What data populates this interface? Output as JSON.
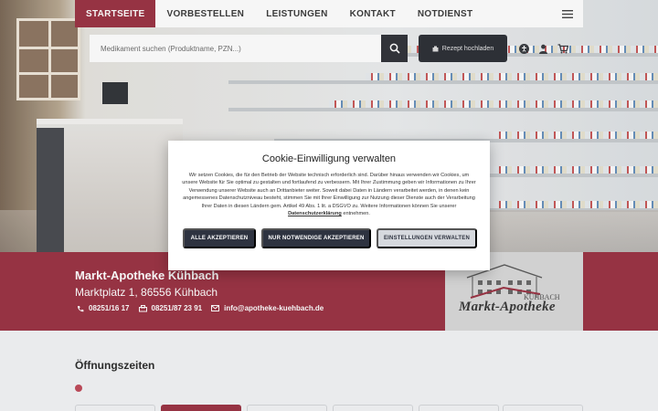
{
  "nav": {
    "items": [
      {
        "label": "STARTSEITE",
        "active": true
      },
      {
        "label": "VORBESTELLEN",
        "active": false
      },
      {
        "label": "LEISTUNGEN",
        "active": false
      },
      {
        "label": "KONTAKT",
        "active": false
      },
      {
        "label": "NOTDIENST",
        "active": false
      }
    ],
    "menu_icon": "hamburger-icon"
  },
  "search": {
    "placeholder": "Medikament suchen (Produktname, PZN...)",
    "button_icon": "search-icon"
  },
  "prescription_button": {
    "label": "Rezept hochladen",
    "icon": "upload-icon"
  },
  "header_icons": [
    "accessibility-icon",
    "user-icon",
    "cart-icon"
  ],
  "pharmacy": {
    "name": "Markt-Apotheke Kühbach",
    "address": "Marktplatz 1, 86556 Kühbach",
    "phone": "08251/16 17",
    "fax": "08251/87 23 91",
    "email": "info@apotheke-kuehbach.de",
    "logo_sub": "KÜHBACH",
    "logo_main": "Markt-Apotheke"
  },
  "hours": {
    "title": "Öffnungszeiten"
  },
  "cookie": {
    "title": "Cookie-Einwilligung verwalten",
    "text": "Wir setzen Cookies, die für den Betrieb der Website technisch erforderlich sind. Darüber hinaus verwenden wir Cookies, um unsere Website für Sie optimal zu gestalten und fortlaufend zu verbessern. Mit Ihrer Zustimmung geben wir Informationen zu Ihrer Verwendung unserer Website auch an Drittanbieter weiter. Soweit dabei Daten in Ländern verarbeitet werden, in denen kein angemessenes Datenschutzniveau besteht, stimmen Sie mit Ihrer Einwilligung zur Nutzung dieser Dienste auch der Verarbeitung Ihrer Daten in diesen Ländern gem. Artikel 49 Abs. 1 lit. a DSGVO zu. Weitere Informationen können Sie unserer",
    "link": "Datenschutzerklärung",
    "text_end": "entnehmen.",
    "buttons": {
      "accept_all": "ALLE AKZEPTIEREN",
      "necessary_only": "NUR NOTWENDIGE AKZEPTIEREN",
      "settings": "EINSTELLUNGEN VERWALTEN"
    }
  },
  "colors": {
    "accent": "#9c3545",
    "dark": "#2e3340"
  }
}
